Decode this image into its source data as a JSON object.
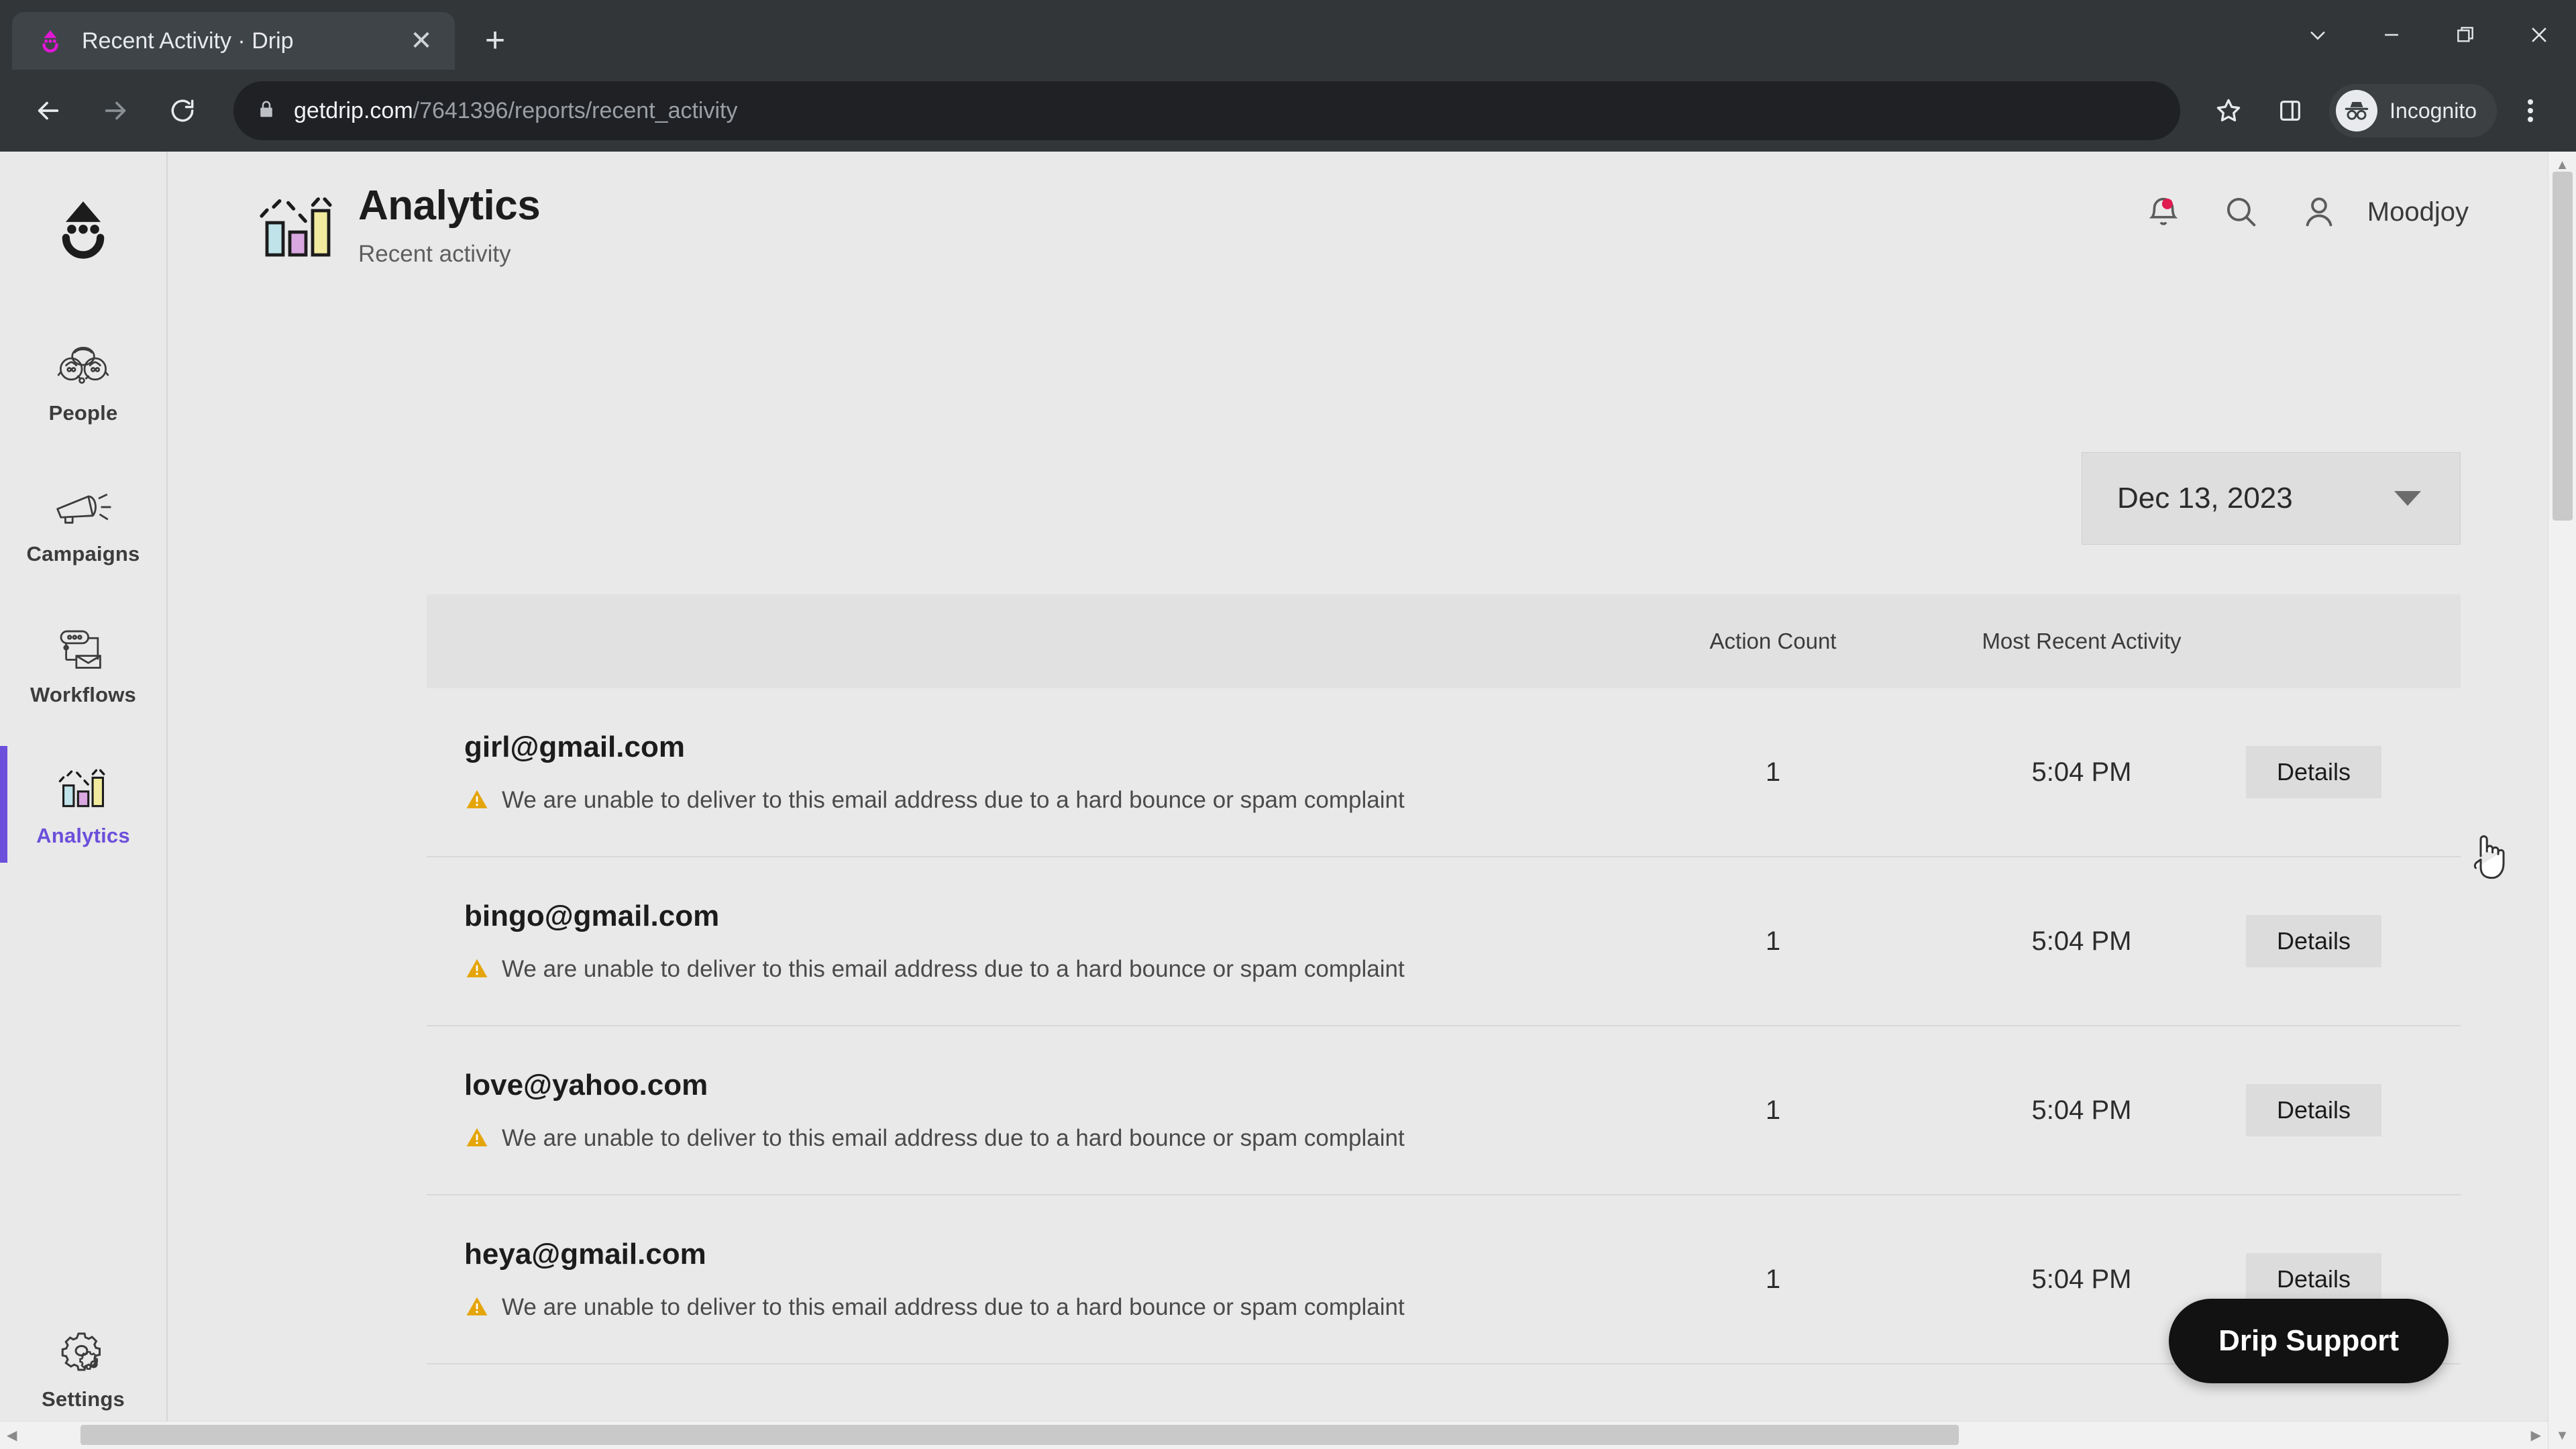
{
  "browser": {
    "tab": {
      "title": "Recent Activity · Drip",
      "favicon_icon": "drip-droplet-icon",
      "close_icon": "close-icon"
    },
    "new_tab_icon": "plus-icon",
    "window_controls": [
      {
        "name": "tab-search-button",
        "icon": "chevron-down-icon"
      },
      {
        "name": "minimize-button",
        "icon": "minimize-icon"
      },
      {
        "name": "restore-button",
        "icon": "restore-icon"
      },
      {
        "name": "close-window-button",
        "icon": "close-icon"
      }
    ],
    "toolbar": {
      "back_icon": "arrow-left-icon",
      "forward_icon": "arrow-right-icon",
      "reload_icon": "reload-icon",
      "lock_icon": "lock-icon",
      "url_domain": "getdrip.com",
      "url_path": "/7641396/reports/recent_activity",
      "bookmark_icon": "star-icon",
      "side_panel_icon": "side-panel-icon",
      "profile_icon": "incognito-icon",
      "profile_label": "Incognito",
      "menu_icon": "kebab-menu-icon"
    }
  },
  "sidebar": {
    "brand_icon": "drip-logo-icon",
    "items": [
      {
        "label": "People",
        "icon": "people-icon",
        "active": false
      },
      {
        "label": "Campaigns",
        "icon": "megaphone-icon",
        "active": false
      },
      {
        "label": "Workflows",
        "icon": "workflow-icon",
        "active": false
      },
      {
        "label": "Analytics",
        "icon": "bar-chart-icon",
        "active": true
      }
    ],
    "bottom_item": {
      "label": "Settings",
      "icon": "gear-icon"
    }
  },
  "header": {
    "icon": "bar-chart-icon",
    "title": "Analytics",
    "subtitle": "Recent activity",
    "notifications_icon": "bell-icon",
    "notifications_badge_color": "#e01a4f",
    "search_icon": "search-icon",
    "account_icon": "person-icon",
    "username": "Moodjoy"
  },
  "date_picker": {
    "value": "Dec 13, 2023",
    "caret_icon": "caret-down-icon"
  },
  "table": {
    "columns": [
      "",
      "Action Count",
      "Most Recent Activity",
      ""
    ],
    "warning_icon": "warning-triangle-icon",
    "warning_color": "#e5a50a",
    "details_label": "Details",
    "rows": [
      {
        "email": "girl@gmail.com",
        "warning": "We are unable to deliver to this email address due to a hard bounce or spam complaint",
        "action_count": "1",
        "most_recent_activity": "5:04 PM",
        "details_label": "Details"
      },
      {
        "email": "bingo@gmail.com",
        "warning": "We are unable to deliver to this email address due to a hard bounce or spam complaint",
        "action_count": "1",
        "most_recent_activity": "5:04 PM",
        "details_label": "Details"
      },
      {
        "email": "love@yahoo.com",
        "warning": "We are unable to deliver to this email address due to a hard bounce or spam complaint",
        "action_count": "1",
        "most_recent_activity": "5:04 PM",
        "details_label": "Details"
      },
      {
        "email": "heya@gmail.com",
        "warning": "We are unable to deliver to this email address due to a hard bounce or spam complaint",
        "action_count": "1",
        "most_recent_activity": "5:04 PM",
        "details_label": "Details"
      }
    ]
  },
  "support": {
    "label": "Drip Support"
  },
  "colors": {
    "accent_purple": "#6c4fdb",
    "page_background": "#e9e9e9",
    "chrome_background": "#323639",
    "warning_amber": "#e5a50a",
    "notification_red": "#e01a4f"
  }
}
